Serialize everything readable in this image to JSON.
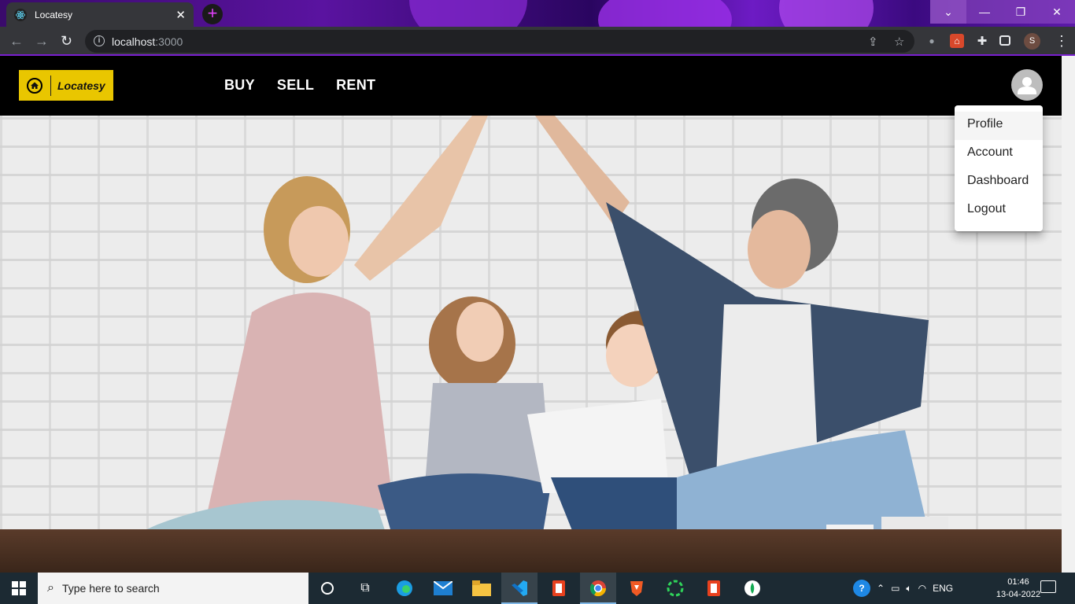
{
  "browser": {
    "tab_title": "Locatesy",
    "url_host": "localhost",
    "url_port": ":3000",
    "profile_initial": "S"
  },
  "site": {
    "logo_text": "Locatesy",
    "nav": [
      "BUY",
      "SELL",
      "RENT"
    ],
    "user_menu": [
      "Profile",
      "Account",
      "Dashboard",
      "Logout"
    ]
  },
  "taskbar": {
    "search_placeholder": "Type here to search",
    "language": "ENG",
    "time": "01:46",
    "date": "13-04-2022"
  },
  "colors": {
    "brand_yellow": "#e9c600",
    "header_black": "#000000",
    "chrome_accent": "#7a1fd0"
  }
}
